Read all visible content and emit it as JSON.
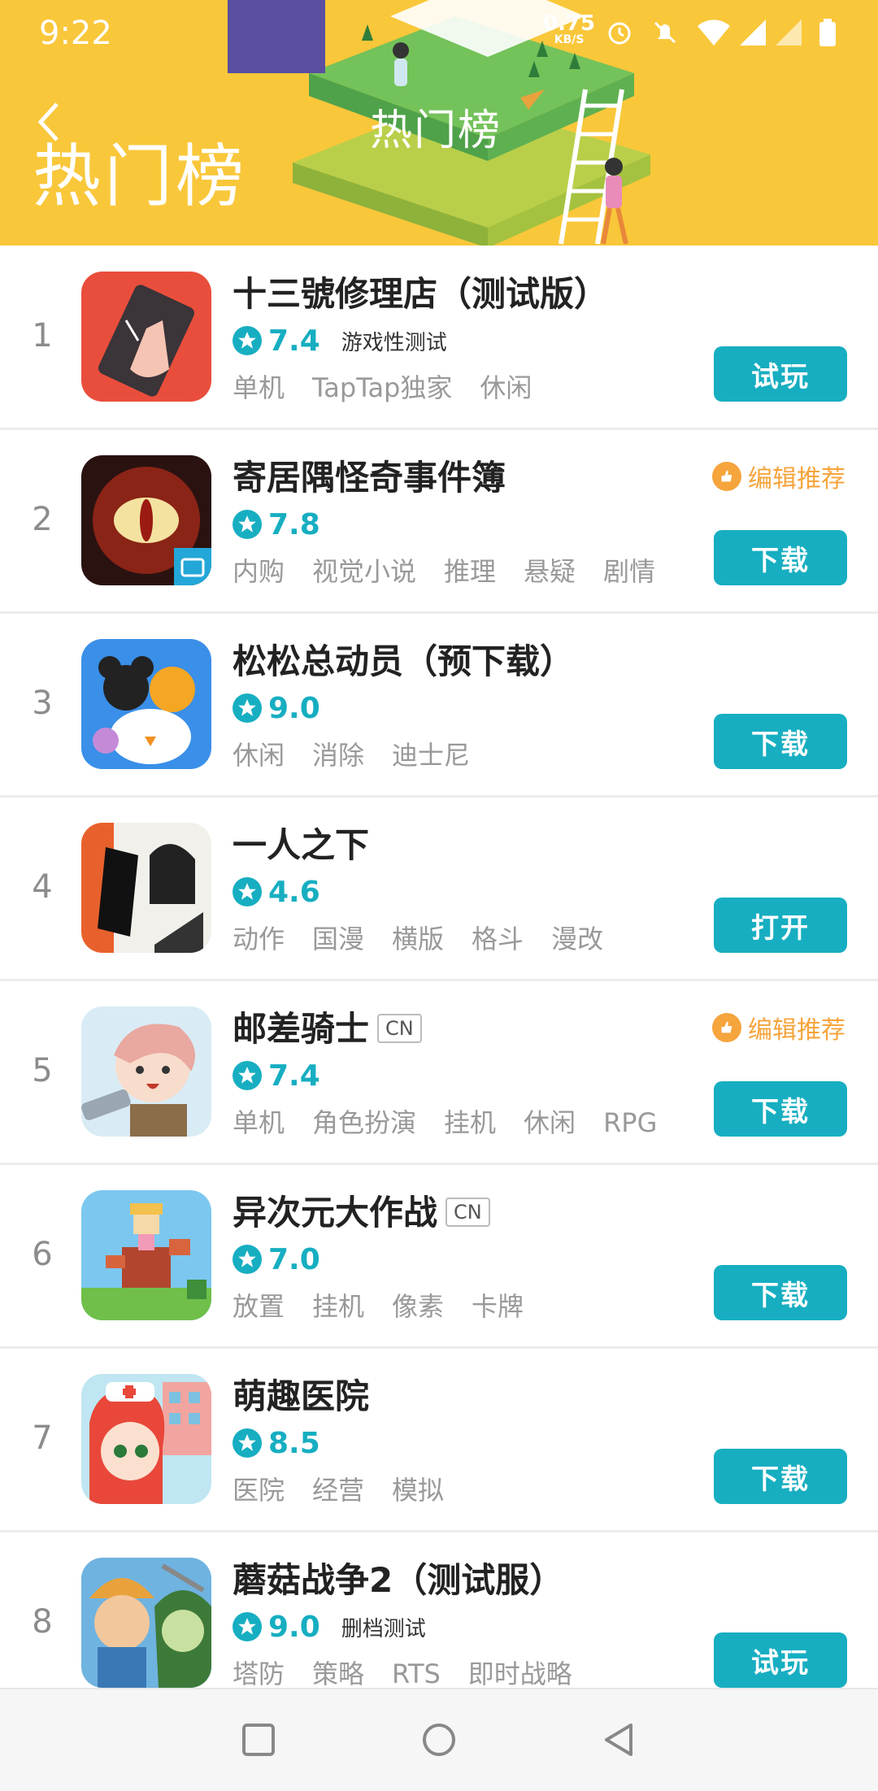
{
  "status_bar": {
    "time": "9:22",
    "net_speed": "0.75",
    "net_unit": "KB/S"
  },
  "header": {
    "title": "热门榜",
    "banner_text": "热门榜"
  },
  "colors": {
    "accent": "#17aec1",
    "banner": "#f9c73a",
    "recommend": "#f6a43c"
  },
  "apps": [
    {
      "rank": "1",
      "name": "十三號修理店（测试版）",
      "cn": "",
      "score": "7.4",
      "status": "游戏性测试",
      "recommend": "",
      "tags": [
        "单机",
        "TapTap独家",
        "休闲"
      ],
      "button": "试玩",
      "icon": "phone-hand-icon"
    },
    {
      "rank": "2",
      "name": "寄居隅怪奇事件簿",
      "cn": "",
      "score": "7.8",
      "status": "",
      "recommend": "编辑推荐",
      "tags": [
        "内购",
        "视觉小说",
        "推理",
        "悬疑",
        "剧情"
      ],
      "button": "下载",
      "icon": "eye-icon"
    },
    {
      "rank": "3",
      "name": "松松总动员（预下载）",
      "cn": "",
      "score": "9.0",
      "status": "",
      "recommend": "",
      "tags": [
        "休闲",
        "消除",
        "迪士尼"
      ],
      "button": "下载",
      "icon": "disney-tsum-icon"
    },
    {
      "rank": "4",
      "name": "一人之下",
      "cn": "",
      "score": "4.6",
      "status": "",
      "recommend": "",
      "tags": [
        "动作",
        "国漫",
        "横版",
        "格斗",
        "漫改"
      ],
      "button": "打开",
      "icon": "ink-character-icon"
    },
    {
      "rank": "5",
      "name": "邮差骑士",
      "cn": "CN",
      "score": "7.4",
      "status": "",
      "recommend": "编辑推荐",
      "tags": [
        "单机",
        "角色扮演",
        "挂机",
        "休闲",
        "RPG"
      ],
      "button": "下载",
      "icon": "knight-girl-icon"
    },
    {
      "rank": "6",
      "name": "异次元大作战",
      "cn": "CN",
      "score": "7.0",
      "status": "",
      "recommend": "",
      "tags": [
        "放置",
        "挂机",
        "像素",
        "卡牌"
      ],
      "button": "下载",
      "icon": "pixel-dragon-icon"
    },
    {
      "rank": "7",
      "name": "萌趣医院",
      "cn": "",
      "score": "8.5",
      "status": "",
      "recommend": "",
      "tags": [
        "医院",
        "经营",
        "模拟"
      ],
      "button": "下载",
      "icon": "nurse-icon"
    },
    {
      "rank": "8",
      "name": "蘑菇战争2（测试服）",
      "cn": "",
      "score": "9.0",
      "status": "删档测试",
      "recommend": "",
      "tags": [
        "塔防",
        "策略",
        "RTS",
        "即时战略"
      ],
      "button": "试玩",
      "icon": "mushroom-war-icon"
    }
  ]
}
